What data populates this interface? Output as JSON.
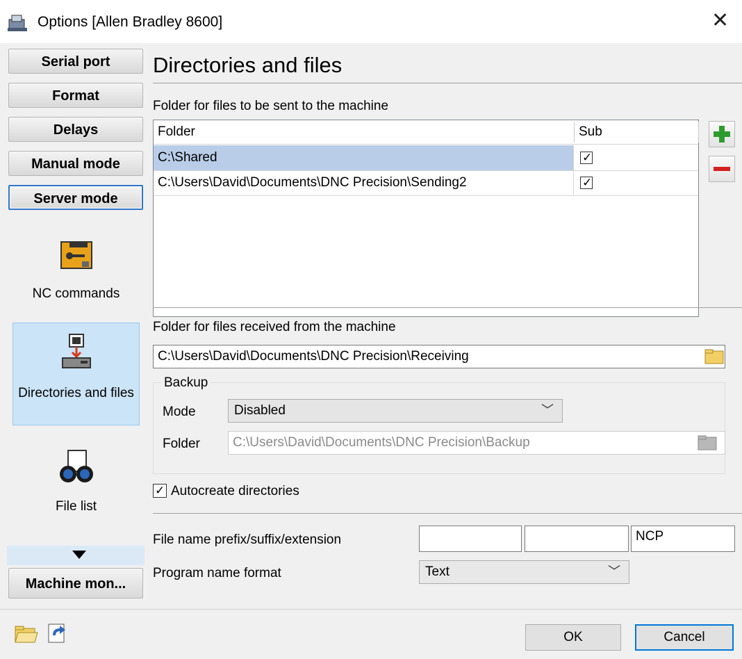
{
  "window": {
    "title": "Options [Allen Bradley 8600]"
  },
  "sidebar": {
    "buttons": [
      "Serial port",
      "Format",
      "Delays",
      "Manual mode",
      "Server mode"
    ],
    "tiles": [
      {
        "label": "NC commands",
        "icon": "nc-commands-icon"
      },
      {
        "label": "Directories and files",
        "icon": "directories-icon"
      },
      {
        "label": "File list",
        "icon": "file-list-icon"
      }
    ],
    "bottom_button": "Machine mon..."
  },
  "main": {
    "title": "Directories and files",
    "send_label": "Folder for files to be sent to the machine",
    "grid": {
      "columns": [
        "Folder",
        "Sub"
      ],
      "rows": [
        {
          "folder": "C:\\Shared",
          "sub": true
        },
        {
          "folder": "C:\\Users\\David\\Documents\\DNC Precision\\Sending2",
          "sub": true
        }
      ]
    },
    "receive_label": "Folder for files received from the machine",
    "receive_value": "C:\\Users\\David\\Documents\\DNC Precision\\Receiving",
    "backup": {
      "legend": "Backup",
      "mode_label": "Mode",
      "mode_value": "Disabled",
      "folder_label": "Folder",
      "folder_value": "C:\\Users\\David\\Documents\\DNC Precision\\Backup"
    },
    "autocreate_label": "Autocreate directories",
    "prefix_label": "File name prefix/suffix/extension",
    "prefix_value": "",
    "suffix_value": "",
    "extension_value": "NCP",
    "program_name_label": "Program name format",
    "program_name_value": "Text"
  },
  "footer": {
    "ok": "OK",
    "cancel": "Cancel"
  },
  "colors": {
    "accent": "#0078d7",
    "selection": "#cce4f7",
    "plus": "#2e9b2e",
    "minus": "#d42020"
  }
}
